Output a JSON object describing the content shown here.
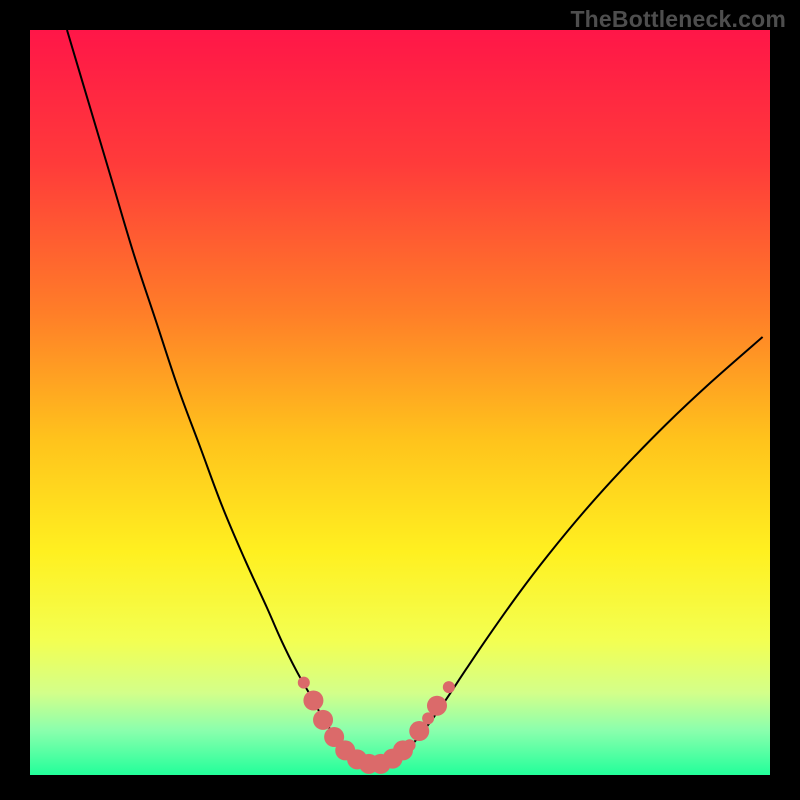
{
  "watermark": "TheBottleneck.com",
  "gradient": {
    "stops": [
      {
        "offset": 0.0,
        "color": "#ff1648"
      },
      {
        "offset": 0.18,
        "color": "#ff3b3a"
      },
      {
        "offset": 0.38,
        "color": "#ff7e28"
      },
      {
        "offset": 0.55,
        "color": "#ffc31c"
      },
      {
        "offset": 0.7,
        "color": "#fff020"
      },
      {
        "offset": 0.82,
        "color": "#f3ff52"
      },
      {
        "offset": 0.89,
        "color": "#d3ff8a"
      },
      {
        "offset": 0.94,
        "color": "#8bffad"
      },
      {
        "offset": 1.0,
        "color": "#22ff9a"
      }
    ]
  },
  "chart_data": {
    "type": "line",
    "title": "",
    "xlabel": "",
    "ylabel": "",
    "xlim": [
      0,
      100
    ],
    "ylim": [
      0,
      100
    ],
    "series": [
      {
        "name": "curve",
        "stroke": "#000000",
        "stroke_width": 2.0,
        "x": [
          5,
          8,
          11,
          14,
          17,
          20,
          23,
          26,
          29,
          32,
          34,
          36,
          38,
          39.5,
          41,
          42.5,
          44,
          46,
          48,
          50,
          52,
          54,
          56,
          59,
          62,
          66,
          70,
          75,
          80,
          86,
          92,
          99
        ],
        "y": [
          100,
          90,
          80,
          70,
          61,
          52,
          44,
          36,
          29,
          22.5,
          18,
          14,
          10.5,
          7.8,
          5.5,
          3.6,
          2.3,
          1.5,
          1.5,
          2.7,
          4.5,
          7.0,
          9.8,
          14.3,
          18.7,
          24.3,
          29.5,
          35.5,
          41.0,
          47.1,
          52.7,
          58.8
        ]
      }
    ],
    "markers": {
      "name": "highlight-dots",
      "fill": "#db6a6a",
      "r_small": 6,
      "r_big": 10,
      "points": [
        {
          "x": 37.0,
          "y": 12.4,
          "r": 6
        },
        {
          "x": 38.3,
          "y": 10.0,
          "r": 10
        },
        {
          "x": 39.6,
          "y": 7.4,
          "r": 10
        },
        {
          "x": 41.1,
          "y": 5.1,
          "r": 10
        },
        {
          "x": 42.6,
          "y": 3.3,
          "r": 10
        },
        {
          "x": 44.2,
          "y": 2.1,
          "r": 10
        },
        {
          "x": 45.8,
          "y": 1.5,
          "r": 10
        },
        {
          "x": 47.4,
          "y": 1.5,
          "r": 10
        },
        {
          "x": 49.0,
          "y": 2.2,
          "r": 10
        },
        {
          "x": 50.4,
          "y": 3.3,
          "r": 10
        },
        {
          "x": 51.3,
          "y": 4.0,
          "r": 6
        },
        {
          "x": 52.6,
          "y": 5.9,
          "r": 10
        },
        {
          "x": 53.8,
          "y": 7.6,
          "r": 6
        },
        {
          "x": 55.0,
          "y": 9.3,
          "r": 10
        },
        {
          "x": 56.6,
          "y": 11.8,
          "r": 6
        }
      ]
    }
  }
}
